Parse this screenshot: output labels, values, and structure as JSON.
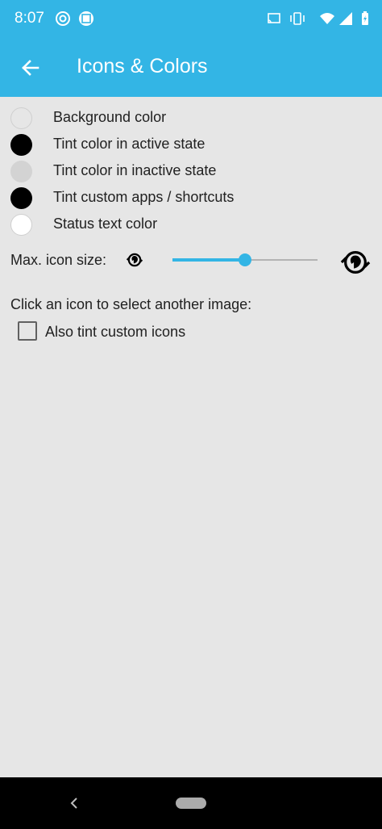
{
  "status_bar": {
    "time": "8:07",
    "left_icons": [
      "notification-icon",
      "screenshot-icon"
    ],
    "right_icons": [
      "cast-icon",
      "vibrate-icon",
      "wifi-icon",
      "signal-icon",
      "battery-icon"
    ]
  },
  "app_bar": {
    "title": "Icons & Colors",
    "back_icon": "arrow-back-icon"
  },
  "colors": {
    "accent": "#33b5e5",
    "background": "#e6e6e6"
  },
  "color_rows": [
    {
      "label": "Background color",
      "swatch": "#e6e6e6"
    },
    {
      "label": "Tint color in active state",
      "swatch": "#000000"
    },
    {
      "label": "Tint color in inactive state",
      "swatch": "#d3d3d3"
    },
    {
      "label": "Tint custom apps / shortcuts",
      "swatch": "#000000"
    },
    {
      "label": "Status text color",
      "swatch": "#ffffff"
    }
  ],
  "icon_size": {
    "label": "Max. icon size:",
    "slider_value": 0.5
  },
  "hint": "Click an icon to select another image:",
  "tint_custom_icons": {
    "label": "Also tint custom icons",
    "checked": false
  }
}
